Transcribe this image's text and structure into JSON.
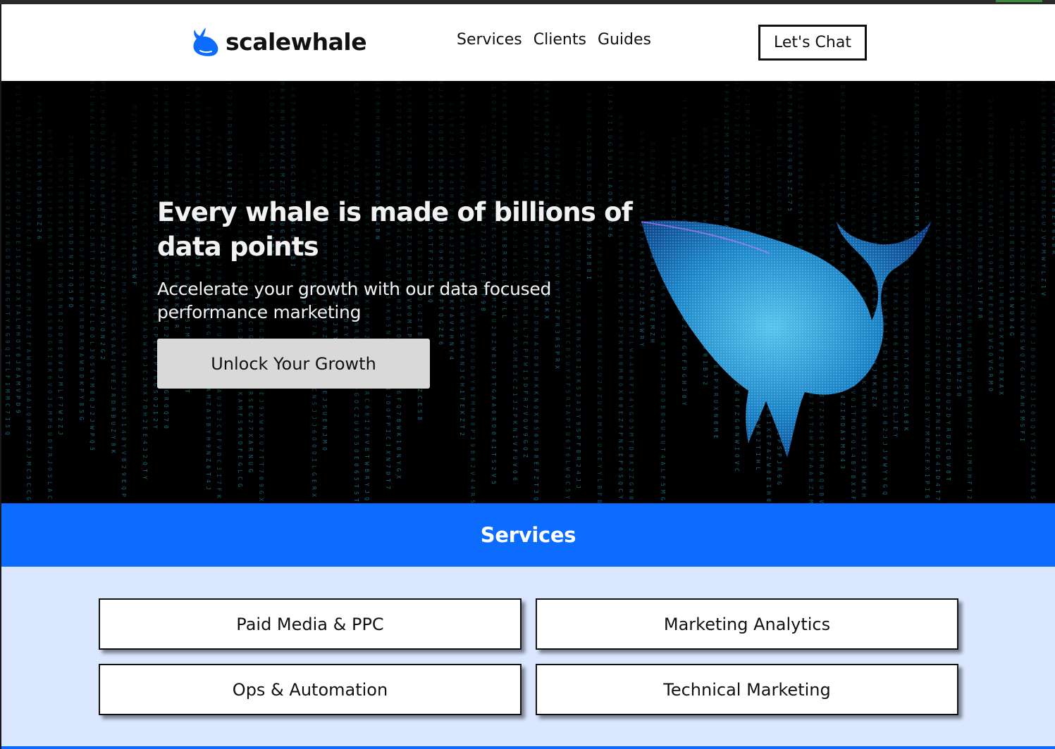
{
  "header": {
    "brand": "scalewhale",
    "nav": [
      "Services",
      "Clients",
      "Guides"
    ],
    "cta": "Let's Chat"
  },
  "hero": {
    "title": "Every whale is made of billions of data points",
    "subtitle": "Accelerate your growth with our data focused performance marketing",
    "button": "Unlock Your Growth"
  },
  "services": {
    "heading": "Services",
    "items": [
      "Paid Media & PPC",
      "Marketing Analytics",
      "Ops & Automation",
      "Technical Marketing"
    ]
  },
  "colors": {
    "brand_blue": "#0b6cff",
    "services_bg": "#dae7ff",
    "hero_bg": "#000000",
    "matrix_cyan": "#2aa6c8"
  },
  "icons": {
    "logo": "whale-icon"
  }
}
